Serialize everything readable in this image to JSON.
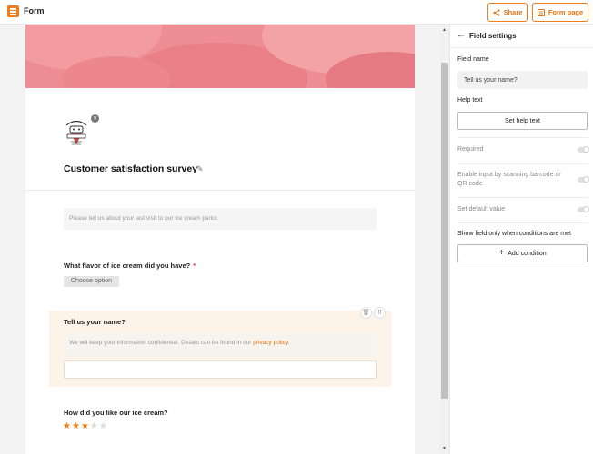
{
  "app": {
    "title": "Form"
  },
  "header": {
    "share_label": "Share",
    "form_page_label": "Form page"
  },
  "form": {
    "title": "Customer satisfaction survey",
    "intro": "Please tell us about your last visit to our ice cream parlor.",
    "questions": [
      {
        "label": "What flavor of ice cream did you have?",
        "required": "*",
        "placeholder": "Choose option"
      },
      {
        "label": "Tell us your name?",
        "help_text": "We will keep your information confidential. Details can be found in our ",
        "help_link": "privacy policy",
        "help_suffix": "."
      },
      {
        "label": "How did you like our ice cream?",
        "rating": 3,
        "rating_max": 5
      }
    ]
  },
  "panel": {
    "title": "Field settings",
    "field_name_label": "Field name",
    "field_name_value": "Tell us your name?",
    "help_text_label": "Help text",
    "set_help_text_label": "Set help text",
    "required_label": "Required",
    "scan_label": "Enable input by scanning barcode or QR code",
    "default_label": "Set default value",
    "conditions_label": "Show field only when conditions are met",
    "add_condition_label": "Add condition"
  },
  "colors": {
    "accent": "#f07d17",
    "hero": "#ee8d93",
    "selected_bg": "#fef3e8"
  },
  "icons": [
    "form-app-icon",
    "share-icon",
    "form-page-icon",
    "close-icon",
    "pencil-icon",
    "trash-icon",
    "drag-handle-icon",
    "star-icon",
    "arrow-left-icon",
    "plus-icon"
  ]
}
